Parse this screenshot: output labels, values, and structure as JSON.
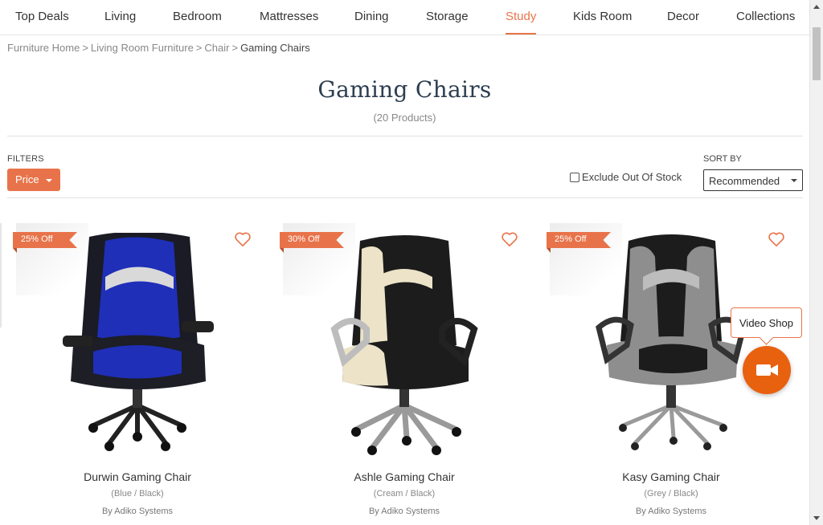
{
  "nav": {
    "items": [
      {
        "label": "Top Deals"
      },
      {
        "label": "Living"
      },
      {
        "label": "Bedroom"
      },
      {
        "label": "Mattresses"
      },
      {
        "label": "Dining"
      },
      {
        "label": "Storage"
      },
      {
        "label": "Study",
        "active": true
      },
      {
        "label": "Kids Room"
      },
      {
        "label": "Decor"
      },
      {
        "label": "Collections"
      }
    ]
  },
  "breadcrumb": {
    "items": [
      "Furniture Home",
      "Living Room Furniture",
      "Chair"
    ],
    "current": "Gaming Chairs",
    "separator": ">"
  },
  "page": {
    "title": "Gaming Chairs",
    "count": "(20 Products)"
  },
  "filters": {
    "label": "FILTERS",
    "price_label": "Price",
    "exclude_label": "Exclude Out Of Stock",
    "exclude_checked": false
  },
  "sort": {
    "label": "SORT BY",
    "selected": "Recommended"
  },
  "products": [
    {
      "badge": "25% Off",
      "name": "Durwin Gaming Chair",
      "variant": "(Blue / Black)",
      "brand": "By Adiko Systems",
      "accent": "#1f2fb8"
    },
    {
      "badge": "30% Off",
      "name": "Ashle Gaming Chair",
      "variant": "(Cream / Black)",
      "brand": "By Adiko Systems",
      "accent": "#ece3c8"
    },
    {
      "badge": "25% Off",
      "name": "Kasy Gaming Chair",
      "variant": "(Grey / Black)",
      "brand": "By Adiko Systems",
      "accent": "#8e8e8e"
    }
  ],
  "video_shop": {
    "label": "Video Shop"
  },
  "colors": {
    "accent": "#e8734a",
    "video_button": "#e8610f",
    "title": "#2d3e50"
  }
}
